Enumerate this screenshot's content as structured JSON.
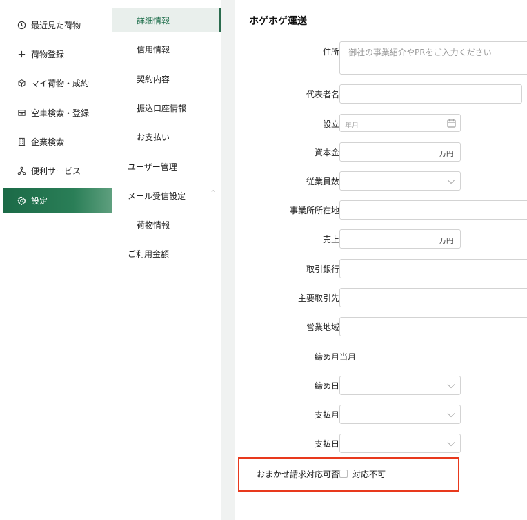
{
  "sidebar": {
    "items": [
      {
        "label": "最近見た荷物",
        "icon": "clock-icon"
      },
      {
        "label": "荷物登録",
        "icon": "plus-icon"
      },
      {
        "label": "マイ荷物・成約",
        "icon": "box-icon"
      },
      {
        "label": "空車検索・登録",
        "icon": "truck-icon"
      },
      {
        "label": "企業検索",
        "icon": "building-icon"
      },
      {
        "label": "便利サービス",
        "icon": "network-icon"
      },
      {
        "label": "設定",
        "icon": "gear-icon",
        "active": true
      }
    ]
  },
  "subnav": {
    "items": [
      {
        "label": "詳細情報",
        "active": true
      },
      {
        "label": "信用情報"
      },
      {
        "label": "契約内容"
      },
      {
        "label": "振込口座情報"
      },
      {
        "label": "お支払い"
      },
      {
        "label": "ユーザー管理"
      },
      {
        "label": "メール受信設定",
        "expanded": true
      },
      {
        "label": "荷物情報"
      },
      {
        "label": "ご利用金額"
      }
    ]
  },
  "panel": {
    "title": "ホゲホゲ運送",
    "fields": {
      "address": {
        "label": "住所",
        "placeholder": "御社の事業紹介やPRをご入力ください",
        "value": ""
      },
      "representative": {
        "label": "代表者名",
        "value": ""
      },
      "established": {
        "label": "設立",
        "placeholder": "年月"
      },
      "capital": {
        "label": "資本金",
        "unit": "万円",
        "value": ""
      },
      "employees": {
        "label": "従業員数",
        "value": ""
      },
      "office": {
        "label": "事業所所在地",
        "value": ""
      },
      "sales": {
        "label": "売上",
        "unit": "万円",
        "value": ""
      },
      "bank": {
        "label": "取引銀行",
        "value": ""
      },
      "clients": {
        "label": "主要取引先",
        "value": ""
      },
      "area": {
        "label": "営業地域",
        "value": ""
      },
      "closing_month": {
        "label": "締め月",
        "value": "当月"
      },
      "closing_day": {
        "label": "締め日",
        "value": ""
      },
      "payment_month": {
        "label": "支払月",
        "value": ""
      },
      "payment_day": {
        "label": "支払日",
        "value": ""
      },
      "omakase": {
        "label": "おまかせ請求対応可否",
        "option": "対応不可",
        "checked": false
      }
    }
  },
  "colors": {
    "accent": "#1b6a47",
    "highlight": "#e8391d"
  }
}
